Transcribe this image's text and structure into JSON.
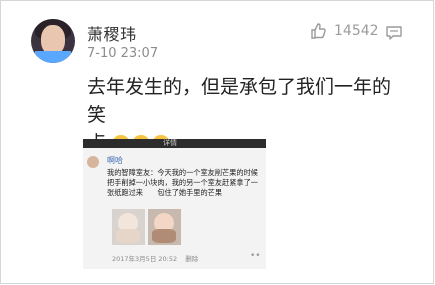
{
  "post": {
    "author": "萧稷玮",
    "time": "7-10 23:07",
    "likes": "14542",
    "text_line1": "去年发生的，但是承包了我们一年的笑",
    "text_line2": "点",
    "emoji": [
      "laugh-cry-emoji",
      "laugh-cry-emoji",
      "laugh-cry-emoji"
    ]
  },
  "embedded": {
    "top_left": "",
    "top_center": "详情",
    "author": "啊哈",
    "text": "我的智障室友：今天我的一个室友削芒果的时候把手削掉一小块肉，我的另一个室友赶紧拿了一张纸跑过来　　包住了她手里的芒果",
    "footer_date": "2017年3月5日 20:52",
    "footer_delete": "删除",
    "more_dots": "••"
  },
  "colors": {
    "text_primary": "#222222",
    "text_secondary": "#8c8c8c",
    "link_blue": "#3d6bb5"
  },
  "icons": {
    "like": "thumb-up-icon",
    "comment": "comment-icon"
  }
}
